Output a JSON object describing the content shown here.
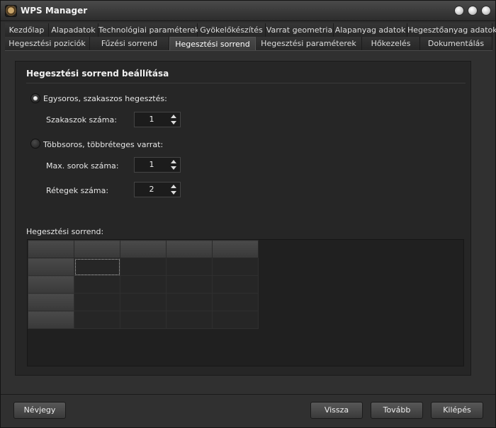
{
  "window": {
    "title": "WPS Manager",
    "icon": "wps-app-icon",
    "controls": [
      "minimize-button",
      "maximize-button",
      "close-button"
    ]
  },
  "tabs": {
    "row1": [
      "Kezdőlap",
      "Alapadatok",
      "Technológiai paraméterek",
      "Gyökelőkészítés",
      "Varrat geometria",
      "Alapanyag adatok",
      "Hegesztőanyag adatok"
    ],
    "row2": [
      "Hegesztési poziciók",
      "Fűzési sorrend",
      "Hegesztési sorrend",
      "Hegesztési paraméterek",
      "Hőkezelés",
      "Dokumentálás"
    ],
    "active": "Hegesztési sorrend"
  },
  "panel": {
    "title": "Hegesztési sorrend beállítása",
    "option1": {
      "label": "Egysoros, szakaszos hegesztés:",
      "checked": true,
      "field_label": "Szakaszok száma:",
      "field_value": "1"
    },
    "option2": {
      "label": "Többsoros, többréteges varrat:",
      "checked": false,
      "field1_label": "Max. sorok száma:",
      "field1_value": "1",
      "field2_label": "Rétegek száma:",
      "field2_value": "2"
    },
    "grid_label": "Hegesztési sorrend:"
  },
  "buttons": {
    "about": "Névjegy",
    "back": "Vissza",
    "next": "Tovább",
    "exit": "Kilépés"
  },
  "colors": {
    "background": "#303030",
    "panel": "#262626",
    "accent_text": "#ffffff"
  }
}
